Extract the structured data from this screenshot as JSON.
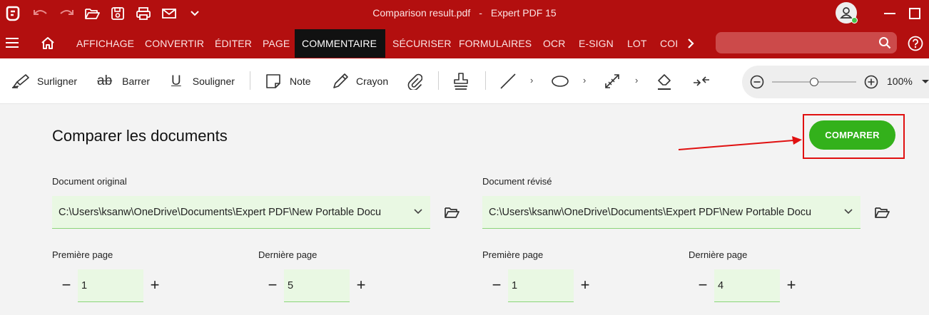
{
  "window": {
    "file_name": "Comparison result.pdf",
    "separator": "-",
    "app_name": "Expert PDF 15"
  },
  "quick_access": [
    "app-logo-icon",
    "undo-icon",
    "redo-icon",
    "open-folder-icon",
    "save-icon",
    "print-icon",
    "mail-icon",
    "chevron-down-icon"
  ],
  "menu": {
    "tabs": [
      {
        "label": "AFFICHAGE"
      },
      {
        "label": "CONVERTIR"
      },
      {
        "label": "ÉDITER"
      },
      {
        "label": "PAGE"
      },
      {
        "label": "COMMENTAIRE",
        "active": true
      },
      {
        "label": "SÉCURISER"
      },
      {
        "label": "FORMULAIRES"
      },
      {
        "label": "OCR"
      },
      {
        "label": "E-SIGN"
      },
      {
        "label": "LOT"
      },
      {
        "label": "COI"
      }
    ]
  },
  "toolbar": {
    "highlight": "Surligner",
    "strike": "Barrer",
    "underline": "Souligner",
    "note": "Note",
    "pencil": "Crayon",
    "zoom": "100%",
    "zoom_level": 0.5
  },
  "main": {
    "title": "Comparer les documents",
    "compare_button": "COMPARER",
    "original": {
      "label": "Document original",
      "path": "C:\\Users\\ksanw\\OneDrive\\Documents\\Expert PDF\\New Portable Docu",
      "first_page_label": "Première page",
      "first_page": "1",
      "last_page_label": "Dernière page",
      "last_page": "5"
    },
    "revised": {
      "label": "Document révisé",
      "path": "C:\\Users\\ksanw\\OneDrive\\Documents\\Expert PDF\\New Portable Docu",
      "first_page_label": "Première page",
      "first_page": "1",
      "last_page_label": "Dernière page",
      "last_page": "4"
    }
  },
  "colors": {
    "brand_red": "#b30f0f",
    "compare_green": "#33b11b",
    "annotation_red": "#e01010"
  }
}
